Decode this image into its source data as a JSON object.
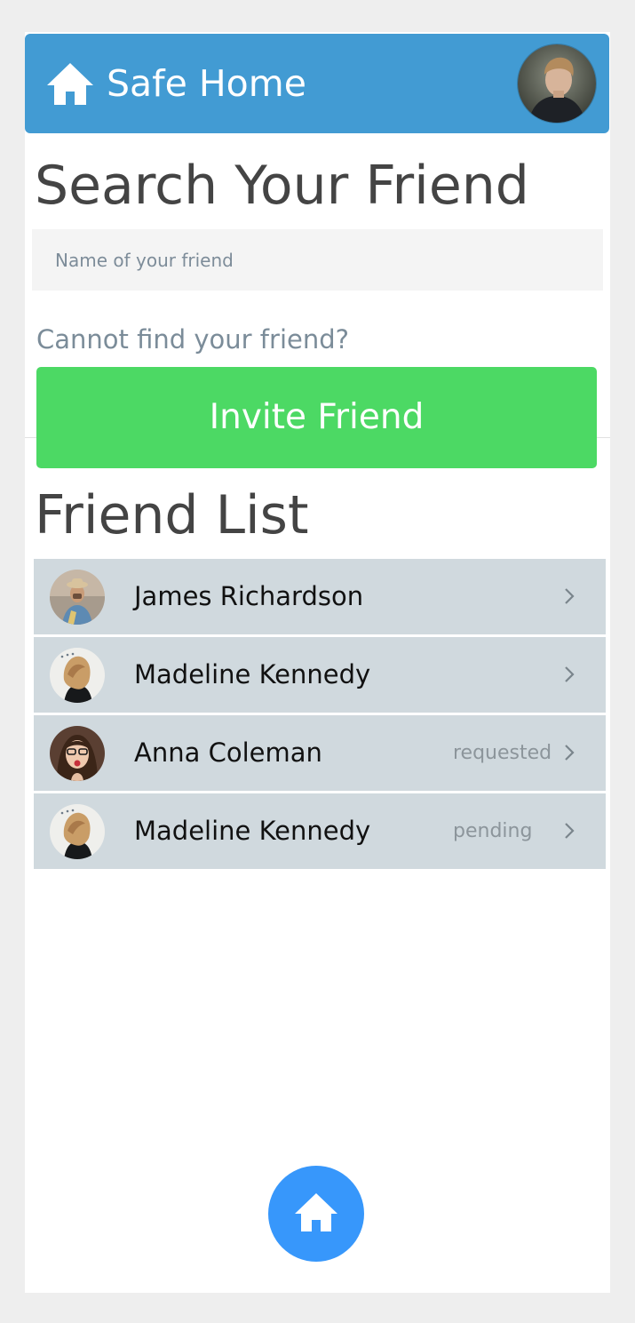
{
  "header": {
    "app_title": "Safe Home",
    "home_icon": "home-icon",
    "avatar": "profile-avatar"
  },
  "search": {
    "title": "Search Your Friend",
    "placeholder": "Name of your friend",
    "value": ""
  },
  "invite": {
    "prompt": "Cannot find your friend?",
    "button_label": "Invite Friend"
  },
  "friend_list": {
    "title": "Friend List",
    "items": [
      {
        "name": "James Richardson",
        "status": "",
        "avatar": "friend-avatar"
      },
      {
        "name": "Madeline Kennedy",
        "status": "",
        "avatar": "friend-avatar"
      },
      {
        "name": "Anna Coleman",
        "status": "requested",
        "avatar": "friend-avatar"
      },
      {
        "name": "Madeline Kennedy",
        "status": "pending",
        "avatar": "friend-avatar"
      }
    ]
  },
  "bottom_nav": {
    "home_icon": "home-icon"
  },
  "colors": {
    "header_bg": "#429bd3",
    "invite_bg": "#4cd964",
    "row_bg": "#d0d9de",
    "fab_bg": "#3797fb",
    "page_bg": "#eeeeee"
  }
}
